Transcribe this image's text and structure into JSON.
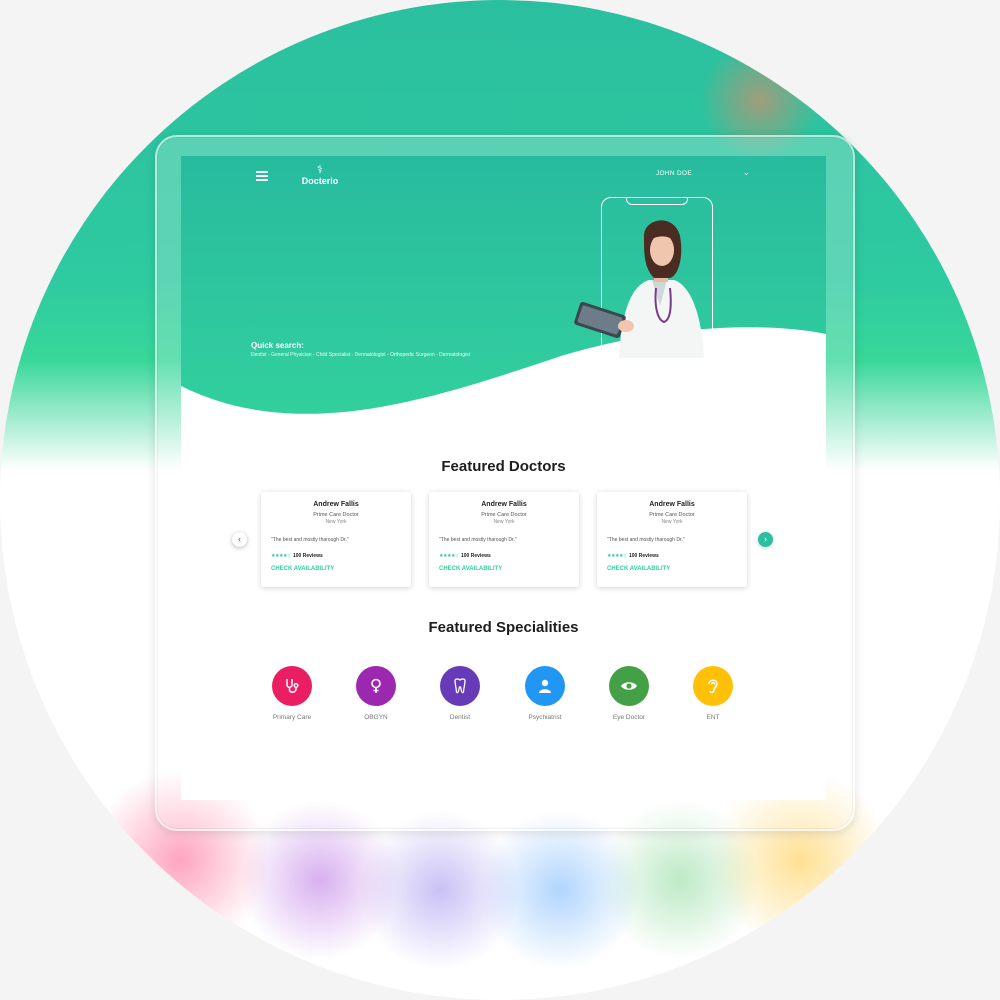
{
  "header": {
    "logo_text": "Docterio",
    "user_name": "JOHN DOE"
  },
  "quick_search": {
    "title": "Quick search:",
    "links": "Dentist - General Physician - Child Specialist - Dermatologist - Orthopedic Surgeon - Dermatologist"
  },
  "featured_doctors": {
    "title": "Featured Doctors",
    "cards": [
      {
        "name": "Andrew Fallis",
        "role": "Prime Care Doctor",
        "city": "New York",
        "quote": "\"The best and mostly tharough Dr.\"",
        "stars": "★★★★☆",
        "reviews": "100 Reviews",
        "cta": "CHECK AVAILABILITY"
      },
      {
        "name": "Andrew Fallis",
        "role": "Prime Care Doctor",
        "city": "New York",
        "quote": "\"The best and mostly tharough Dr.\"",
        "stars": "★★★★☆",
        "reviews": "100 Reviews",
        "cta": "CHECK AVAILABILITY"
      },
      {
        "name": "Andrew Fallis",
        "role": "Prime Care Doctor",
        "city": "New York",
        "quote": "\"The best and mostly tharough Dr.\"",
        "stars": "★★★★☆",
        "reviews": "100 Reviews",
        "cta": "CHECK AVAILABILITY"
      }
    ]
  },
  "featured_specialities": {
    "title": "Featured Specialities",
    "items": [
      {
        "label": "Primary Care",
        "icon": "stethoscope-icon",
        "color": "#e91e63"
      },
      {
        "label": "OBGYN",
        "icon": "female-symbol-icon",
        "color": "#9c27b0"
      },
      {
        "label": "Dentist",
        "icon": "tooth-icon",
        "color": "#673ab7"
      },
      {
        "label": "Psychiatrist",
        "icon": "person-icon",
        "color": "#2196f3"
      },
      {
        "label": "Eye Doctor",
        "icon": "eye-icon",
        "color": "#43a047"
      },
      {
        "label": "ENT",
        "icon": "ear-icon",
        "color": "#ffc107"
      }
    ]
  },
  "colors": {
    "brand": "#2bbf9f",
    "brand_light": "#32d09d"
  }
}
